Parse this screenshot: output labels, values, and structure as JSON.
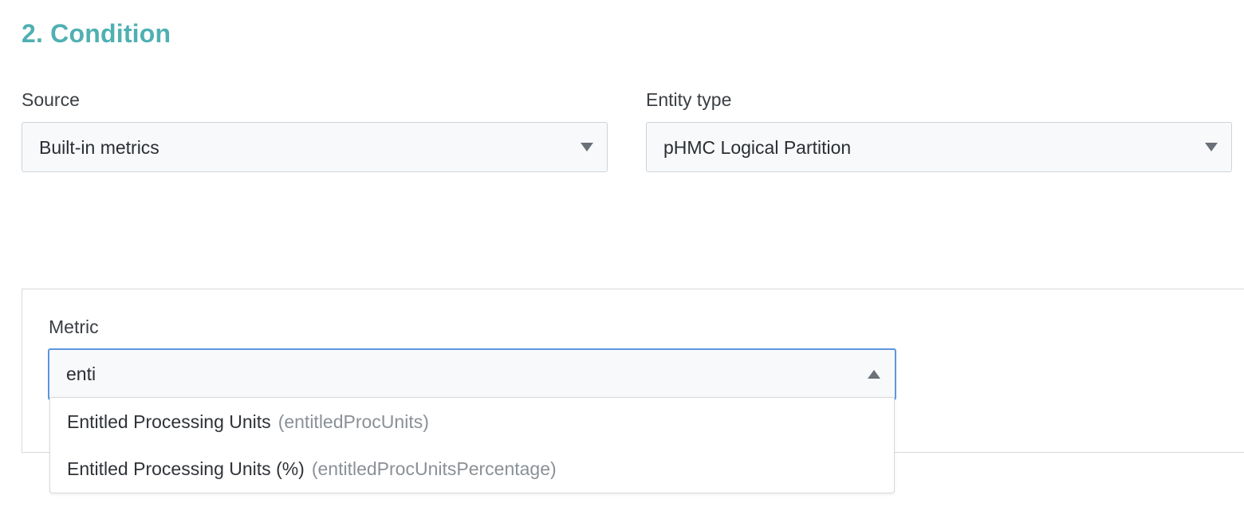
{
  "section": {
    "title": "2. Condition"
  },
  "source": {
    "label": "Source",
    "value": "Built-in metrics"
  },
  "entity_type": {
    "label": "Entity type",
    "value": "pHMC Logical Partition"
  },
  "metric": {
    "label": "Metric",
    "query": "enti",
    "options": [
      {
        "name": "Entitled Processing Units",
        "key": "(entitledProcUnits)"
      },
      {
        "name": "Entitled Processing Units (%)",
        "key": "(entitledProcUnitsPercentage)"
      }
    ]
  },
  "colors": {
    "title_accent": "#4fb0b2",
    "focus_border": "#5b96e0",
    "field_bg": "#f8f9fa"
  }
}
